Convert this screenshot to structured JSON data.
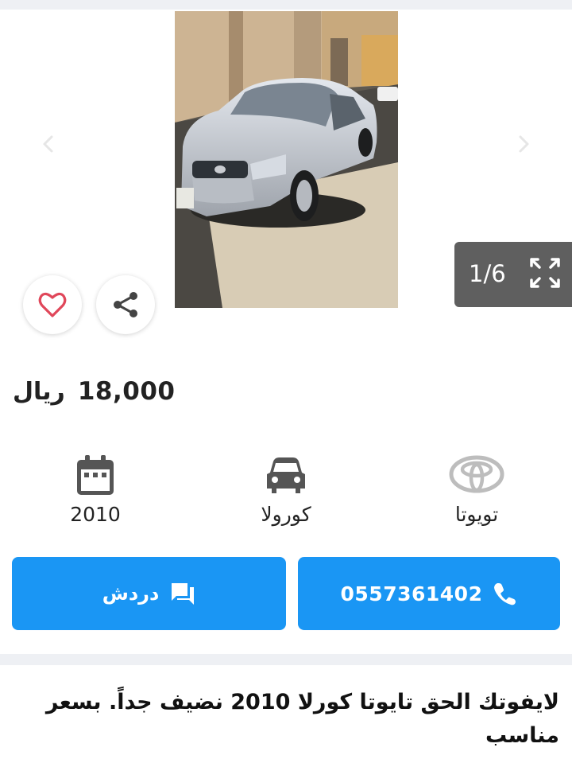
{
  "gallery": {
    "counter": "1/6",
    "icons": {
      "prev": "chevron-left-icon",
      "next": "chevron-right-icon",
      "expand": "expand-icon",
      "share": "share-icon",
      "favorite": "heart-icon"
    }
  },
  "listing": {
    "price_value": "18,000",
    "price_currency": "ريال",
    "specs": {
      "year": {
        "value": "2010",
        "icon": "calendar-icon"
      },
      "model": {
        "value": "كورولا",
        "icon": "car-icon"
      },
      "make": {
        "value": "تويوتا",
        "icon": "toyota-logo-icon"
      }
    },
    "description": "لايفوتك الحق تايوتا كورلا 2010 نضيف جداً. بسعر مناسب"
  },
  "actions": {
    "chat_label": "دردش",
    "phone_number": "0557361402"
  },
  "colors": {
    "accent": "#1a96f4",
    "favorite": "#e0475a",
    "counter_bg": "#5f5f5f"
  }
}
